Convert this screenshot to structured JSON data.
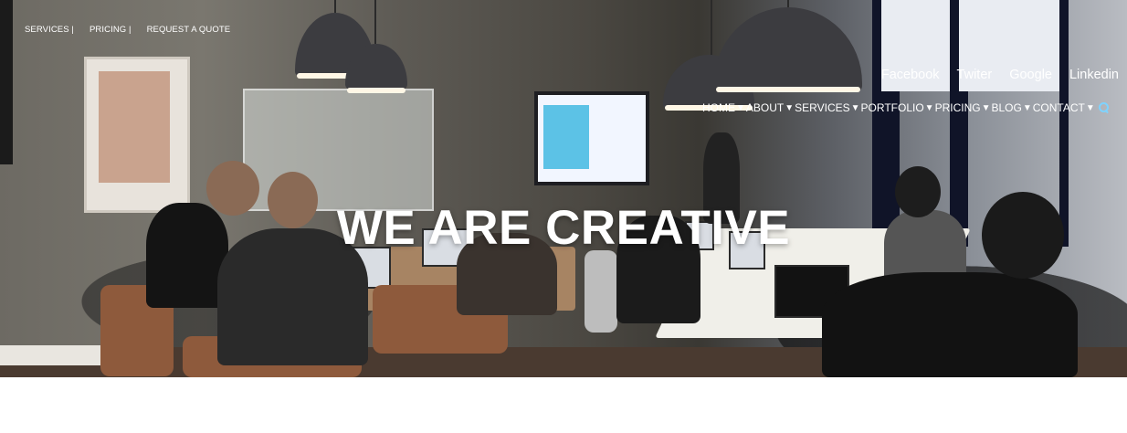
{
  "top_nav": {
    "items": [
      {
        "label": "SERVICES |"
      },
      {
        "label": "PRICING |"
      },
      {
        "label": "REQUEST A QUOTE"
      }
    ]
  },
  "social": {
    "links": [
      {
        "label": "Facebook"
      },
      {
        "label": "Twiter"
      },
      {
        "label": "Google"
      },
      {
        "label": "Linkedin"
      }
    ]
  },
  "main_nav": {
    "items": [
      {
        "label": "HOME",
        "caret": "▼"
      },
      {
        "label": "ABOUT",
        "caret": "▼"
      },
      {
        "label": "SERVICES",
        "caret": "▼"
      },
      {
        "label": "PORTFOLIO",
        "caret": "▼"
      },
      {
        "label": "PRICING",
        "caret": "▼"
      },
      {
        "label": "BLOG",
        "caret": "▼"
      },
      {
        "label": "CONTACT",
        "caret": "▼"
      }
    ],
    "search_icon": "search-icon",
    "search_icon_color": "#7fd3ff"
  },
  "hero": {
    "title": "WE ARE CREATIVE",
    "background": "office-coworking-photo"
  }
}
